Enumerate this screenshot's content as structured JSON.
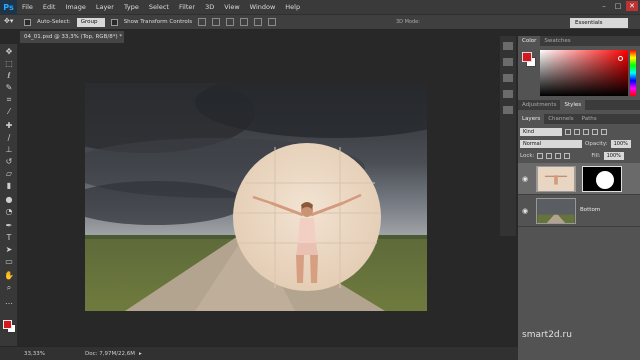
{
  "app": {
    "logo": "Ps"
  },
  "menu": [
    "File",
    "Edit",
    "Image",
    "Layer",
    "Type",
    "Select",
    "Filter",
    "3D",
    "View",
    "Window",
    "Help"
  ],
  "window_controls": [
    "minimize-icon",
    "maximize-icon",
    "close-icon"
  ],
  "options": {
    "auto_select_label": "Auto-Select:",
    "auto_select_value": "Group",
    "show_transform_label": "Show Transform Controls",
    "mode_3d_label": "3D Mode:",
    "workspace": "Essentials"
  },
  "document": {
    "tab_title": "04_01.psd @ 33,3% (Top, RGB/8*) *"
  },
  "tools": [
    "move-icon",
    "marquee-icon",
    "lasso-icon",
    "quick-select-icon",
    "crop-icon",
    "eyedropper-icon",
    "healing-icon",
    "brush-icon",
    "clone-stamp-icon",
    "history-brush-icon",
    "eraser-icon",
    "gradient-icon",
    "blur-icon",
    "dodge-icon",
    "pen-icon",
    "type-icon",
    "path-select-icon",
    "rectangle-icon",
    "hand-icon",
    "zoom-icon"
  ],
  "colors": {
    "foreground": "#d8161e",
    "background": "#ffffff",
    "accent_ps": "#31a8ff"
  },
  "status": {
    "zoom": "33,33%",
    "doc_info": "Doc: 7,97M/22,6M"
  },
  "panels": {
    "color_tabs": [
      "Color",
      "Swatches"
    ],
    "adjust_tabs": [
      "Adjustments",
      "Styles"
    ],
    "layers_tabs": [
      "Layers",
      "Channels",
      "Paths"
    ],
    "filter_kind": "Kind",
    "blend_mode": "Normal",
    "opacity_label": "Opacity:",
    "opacity_value": "100%",
    "lock_label": "Lock:",
    "fill_label": "Fill:",
    "fill_value": "100%",
    "layers": [
      {
        "name": "Top",
        "visible": true,
        "selected": true,
        "has_mask": true
      },
      {
        "name": "Bottom",
        "visible": true,
        "selected": false,
        "has_mask": false
      }
    ]
  },
  "watermark": "smart2d.ru"
}
